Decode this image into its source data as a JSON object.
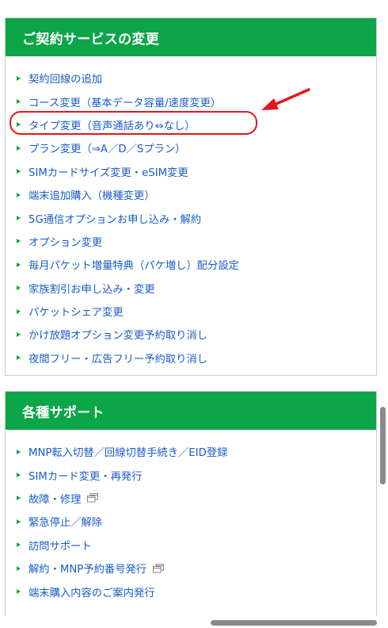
{
  "contract_section": {
    "title": "ご契約サービスの変更",
    "items": [
      {
        "label": "契約回線の追加"
      },
      {
        "label": "コース変更（基本データ容量/速度変更）"
      },
      {
        "label": "タイプ変更（音声通話あり⇔なし）",
        "highlighted": true
      },
      {
        "label": "プラン変更（⇒A／D／Sプラン）"
      },
      {
        "label": "SIMカードサイズ変更・eSIM変更"
      },
      {
        "label": "端末追加購入（機種変更）"
      },
      {
        "label": "5G通信オプションお申し込み・解約"
      },
      {
        "label": "オプション変更"
      },
      {
        "label": "毎月パケット増量特典（パケ増し）配分設定"
      },
      {
        "label": "家族割引お申し込み・変更"
      },
      {
        "label": "パケットシェア変更"
      },
      {
        "label": "かけ放題オプション変更予約取り消し"
      },
      {
        "label": "夜間フリー・広告フリー予約取り消し"
      }
    ]
  },
  "support_section": {
    "title": "各種サポート",
    "items": [
      {
        "label": "MNP転入切替／回線切替手続き／EID登録"
      },
      {
        "label": "SIMカード変更・再発行"
      },
      {
        "label": "故障・修理",
        "external_icon": "external-window-icon"
      },
      {
        "label": "緊急停止／解除"
      },
      {
        "label": "訪問サポート"
      },
      {
        "label": "解約・MNP予約番号発行",
        "external_icon": "external-window-icon"
      },
      {
        "label": "端末購入内容のご案内発行"
      }
    ]
  },
  "colors": {
    "header_green": "#0ca547",
    "link_blue": "#1a5cc8",
    "annotation_red": "#e3161b"
  }
}
